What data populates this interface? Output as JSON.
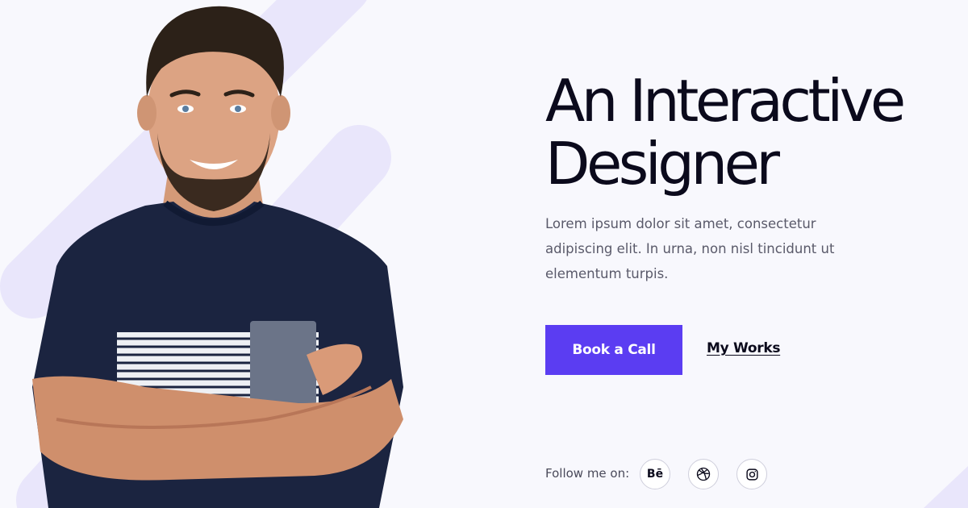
{
  "hero": {
    "title_line1": "An Interactive",
    "title_line2": "Designer",
    "description": "Lorem ipsum dolor sit amet, consectetur adipiscing elit. In urna, non nisl tincidunt ut elementum turpis."
  },
  "actions": {
    "primary_label": "Book a Call",
    "secondary_label": "My Works"
  },
  "social": {
    "label": "Follow me on:",
    "icons": [
      "behance-icon",
      "dribbble-icon",
      "instagram-icon"
    ],
    "behance_text": "Bē"
  },
  "colors": {
    "accent": "#5b3df2",
    "background": "#f8f8fd",
    "decor": "#e9e6fb",
    "text_dark": "#0b0a1c"
  }
}
